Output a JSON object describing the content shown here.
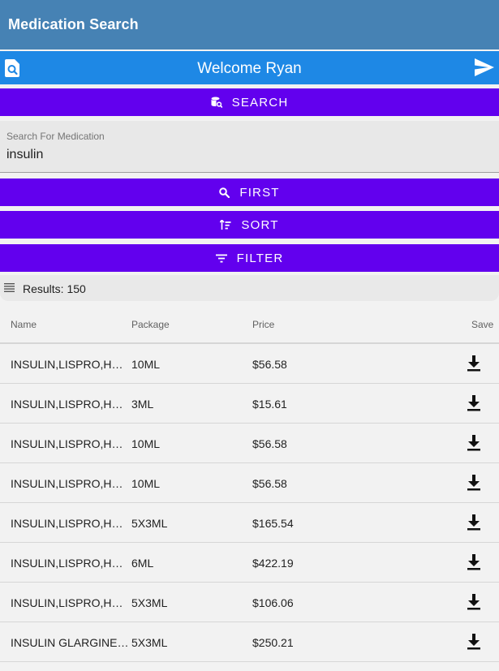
{
  "appbar": {
    "title": "Medication Search"
  },
  "welcome": {
    "text": "Welcome Ryan",
    "left_icon": "search-document-icon",
    "right_icon": "send-icon"
  },
  "buttons": {
    "search": "SEARCH",
    "first": "FIRST",
    "sort": "SORT",
    "filter": "FILTER"
  },
  "search": {
    "label": "Search For Medication",
    "value": "insulin"
  },
  "results": {
    "text": "Results: 150"
  },
  "table": {
    "headers": {
      "name": "Name",
      "package": "Package",
      "price": "Price",
      "save": "Save"
    },
    "rows": [
      {
        "name": "INSULIN,LISPRO,HUMAN",
        "package": "10ML",
        "price": "$56.58"
      },
      {
        "name": "INSULIN,LISPRO,HUMAN",
        "package": "3ML",
        "price": "$15.61"
      },
      {
        "name": "INSULIN,LISPRO,HUMAN",
        "package": "10ML",
        "price": "$56.58"
      },
      {
        "name": "INSULIN,LISPRO,HUMAN",
        "package": "10ML",
        "price": "$56.58"
      },
      {
        "name": "INSULIN,LISPRO,HUMAN",
        "package": "5X3ML",
        "price": "$165.54"
      },
      {
        "name": "INSULIN,LISPRO,HUMAN",
        "package": "6ML",
        "price": "$422.19"
      },
      {
        "name": "INSULIN,LISPRO,HUMAN",
        "package": "5X3ML",
        "price": "$106.06"
      },
      {
        "name": "INSULIN GLARGINE,HUMAN",
        "package": "5X3ML",
        "price": "$250.21"
      }
    ]
  },
  "colors": {
    "appbar": "#4682b4",
    "welcome_bar": "#1e88e5",
    "button": "#6200ee",
    "background": "#f2f2f2"
  }
}
